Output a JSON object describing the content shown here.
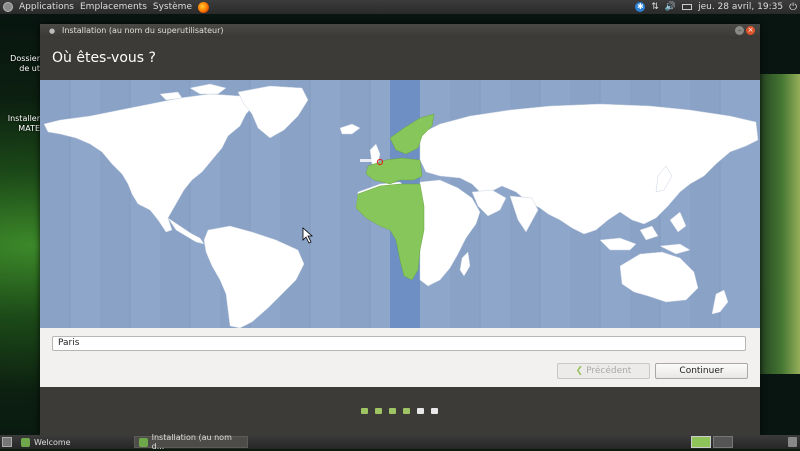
{
  "top_panel": {
    "menus": [
      "Applications",
      "Emplacements",
      "Système"
    ],
    "clock": "jeu. 28 avril, 19:35"
  },
  "desktop": {
    "icons": [
      "Dossier de ut",
      "Installer MATE"
    ]
  },
  "window": {
    "title": "Installation (au nom du superutilisateur)",
    "heading": "Où êtes-vous ?",
    "timezone_value": "Paris",
    "prev_label": "Précédent",
    "next_label": "Continuer",
    "progress": {
      "done": 4,
      "total": 6
    }
  },
  "taskbar": {
    "items": [
      "Welcome",
      "Installation (au nom d..."
    ]
  },
  "colors": {
    "ocean": "#8ea6c9",
    "selected_zone": "#6d8fc4",
    "highlight_land": "#86c65a",
    "accent": "#9ec464"
  },
  "icons": [
    "mint-logo-icon",
    "firefox-icon",
    "accessibility-icon",
    "network-icon",
    "volume-icon",
    "battery-icon",
    "power-icon",
    "close-icon",
    "minimize-icon",
    "chevron-left-icon",
    "trash-icon"
  ]
}
